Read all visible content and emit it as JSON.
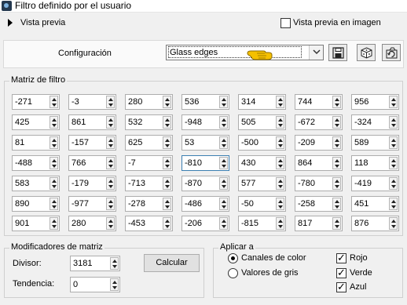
{
  "window": {
    "title": "Filtro definido por el usuario"
  },
  "preview": {
    "label": "Vista previa",
    "image_preview_label": "Vista previa en imagen",
    "image_preview_checked": false
  },
  "config": {
    "label": "Configuración",
    "selected": "Glass edges"
  },
  "matrix": {
    "title": "Matriz de filtro",
    "rows": [
      [
        "-271",
        "-3",
        "280",
        "536",
        "314",
        "744",
        "956"
      ],
      [
        "425",
        "861",
        "532",
        "-948",
        "505",
        "-672",
        "-324"
      ],
      [
        "81",
        "-157",
        "625",
        "53",
        "-500",
        "-209",
        "589"
      ],
      [
        "-488",
        "766",
        "-7",
        "-810",
        "430",
        "864",
        "118"
      ],
      [
        "583",
        "-179",
        "-713",
        "-870",
        "577",
        "-780",
        "-419"
      ],
      [
        "890",
        "-977",
        "-278",
        "-486",
        "-50",
        "-258",
        "451"
      ],
      [
        "901",
        "280",
        "-453",
        "-206",
        "-815",
        "817",
        "876"
      ]
    ]
  },
  "modifiers": {
    "title": "Modificadores de matriz",
    "divisor_label": "Divisor:",
    "divisor_value": "3181",
    "tendency_label": "Tendencia:",
    "tendency_value": "0",
    "calculate_label": "Calcular"
  },
  "apply": {
    "title": "Aplicar a",
    "color_channels_label": "Canales de color",
    "color_channels_selected": true,
    "gray_values_label": "Valores de gris",
    "gray_values_selected": false,
    "red_label": "Rojo",
    "red_checked": true,
    "green_label": "Verde",
    "green_checked": true,
    "blue_label": "Azul",
    "blue_checked": true
  },
  "colors": {
    "window_bg": "#f0f0f0",
    "hand_pointer": "#f5c000",
    "focus_border": "#3c7fb1"
  }
}
